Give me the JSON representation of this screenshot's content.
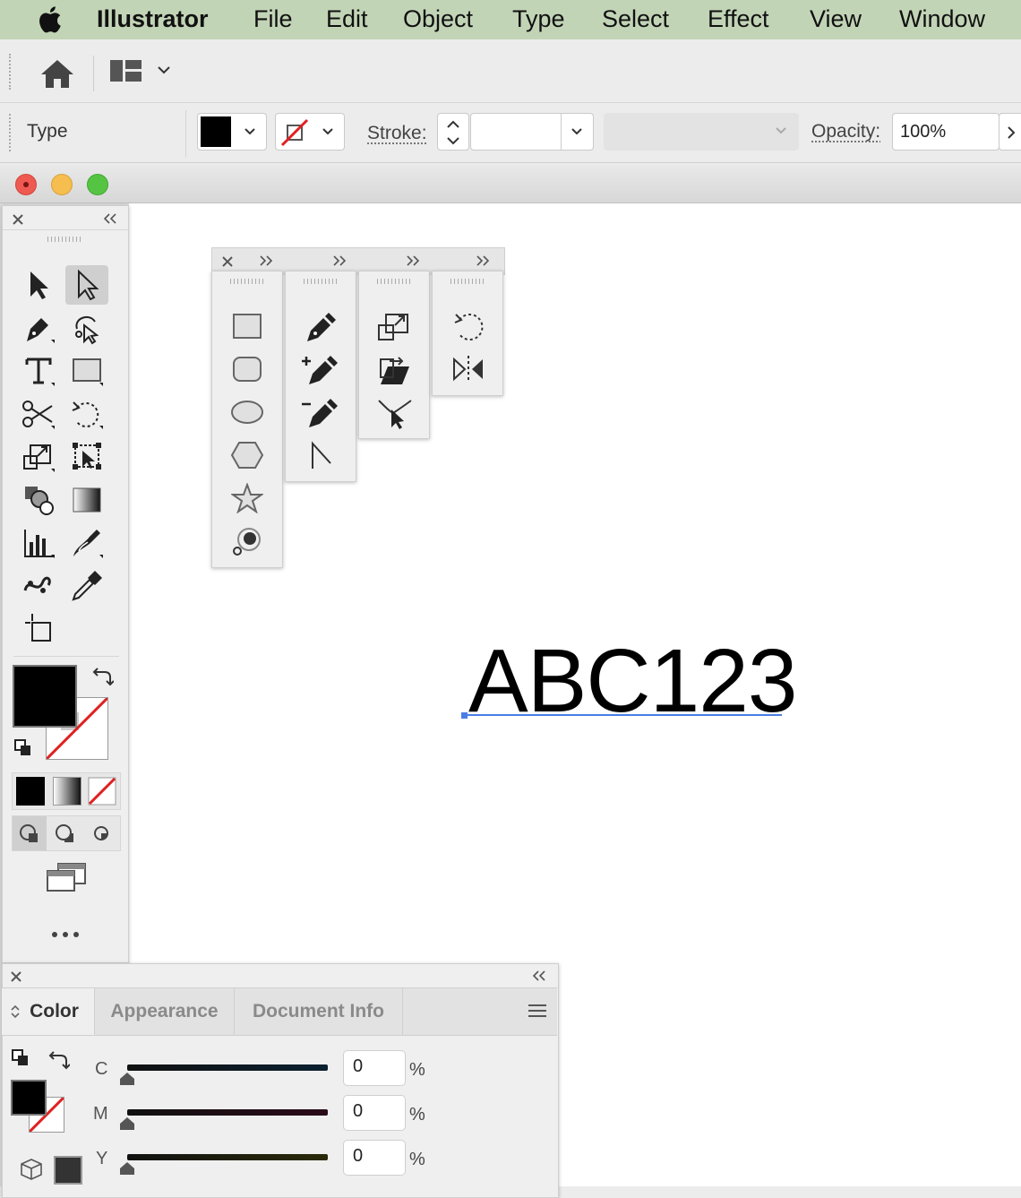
{
  "menubar": {
    "app_name": "Illustrator",
    "items": [
      "File",
      "Edit",
      "Object",
      "Type",
      "Select",
      "Effect",
      "View",
      "Window"
    ]
  },
  "control_bar": {
    "mode_label": "Type",
    "stroke_label": "Stroke:",
    "opacity_label": "Opacity:",
    "opacity_value": "100%"
  },
  "canvas": {
    "text": "ABC123",
    "baseline_color": "#4a7ee6"
  },
  "color_panel": {
    "tabs": [
      "Color",
      "Appearance",
      "Document Info"
    ],
    "active_tab": "Color",
    "channels": [
      {
        "label": "C",
        "value": "0",
        "unit": "%"
      },
      {
        "label": "M",
        "value": "0",
        "unit": "%"
      },
      {
        "label": "Y",
        "value": "0",
        "unit": "%"
      }
    ]
  },
  "colors": {
    "menubar": "#c2d4b6",
    "fill": "#000000",
    "none_stroke": "#e02020"
  }
}
